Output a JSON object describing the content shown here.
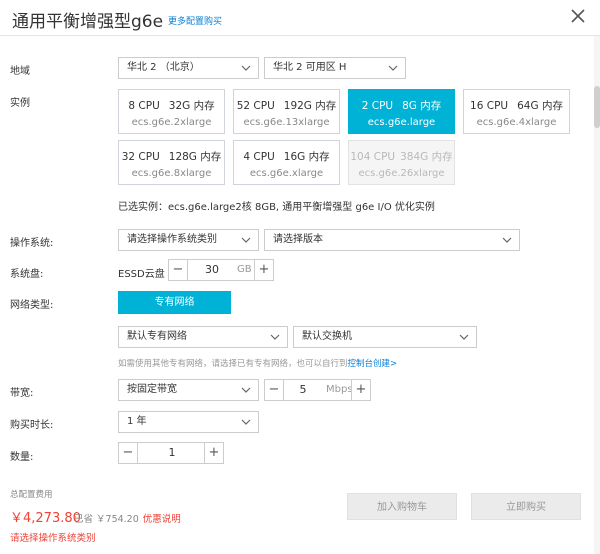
{
  "header": {
    "title": "通用平衡增强型g6e",
    "more_link": "更多配置购买"
  },
  "region": {
    "label": "地域",
    "region_value": "华北 2 （北京）",
    "zone_value": "华北 2 可用区 H"
  },
  "instance": {
    "label": "实例",
    "cards": [
      {
        "cpu": "8 CPU",
        "mem": "32G 内存",
        "type": "ecs.g6e.2xlarge",
        "state": "normal"
      },
      {
        "cpu": "52 CPU",
        "mem": "192G 内存",
        "type": "ecs.g6e.13xlarge",
        "state": "normal"
      },
      {
        "cpu": "2 CPU",
        "mem": "8G 内存",
        "type": "ecs.g6e.large",
        "state": "selected"
      },
      {
        "cpu": "16 CPU",
        "mem": "64G 内存",
        "type": "ecs.g6e.4xlarge",
        "state": "normal"
      },
      {
        "cpu": "32 CPU",
        "mem": "128G 内存",
        "type": "ecs.g6e.8xlarge",
        "state": "normal"
      },
      {
        "cpu": "4 CPU",
        "mem": "16G 内存",
        "type": "ecs.g6e.xlarge",
        "state": "normal"
      },
      {
        "cpu": "104 CPU",
        "mem": "384G 内存",
        "type": "ecs.g6e.26xlarge",
        "state": "disabled"
      }
    ],
    "selected_summary": "已选实例：ecs.g6e.large2核 8GB, 通用平衡增强型 g6e I/O 优化实例"
  },
  "os": {
    "label": "操作系统:",
    "type_placeholder": "请选择操作系统类别",
    "version_placeholder": "请选择版本"
  },
  "disk": {
    "label": "系统盘:",
    "type": "ESSD云盘",
    "size": "30",
    "unit": "GB"
  },
  "network": {
    "label": "网络类型:",
    "button": "专有网络",
    "vpc": "默认专有网络",
    "vswitch": "默认交换机",
    "hint": "如需使用其他专有网络，请选择已有专有网络，也可以自行到",
    "hint_link": "控制台创建>"
  },
  "bandwidth": {
    "label": "带宽:",
    "mode": "按固定带宽",
    "value": "5",
    "unit": "Mbps"
  },
  "duration": {
    "label": "购买时长:",
    "value": "1 年"
  },
  "quantity": {
    "label": "数量:",
    "value": "1"
  },
  "footer": {
    "total_label": "总配置费用",
    "price": "￥4,273.80",
    "saved": "已省 ￥754.20",
    "promo": "优惠说明",
    "warning": "请选择操作系统类别",
    "add_cart": "加入购物车",
    "buy_now": "立即购买"
  },
  "colors": {
    "accent": "#00b2d6",
    "price": "#f04134",
    "link": "#0a7fd6"
  }
}
